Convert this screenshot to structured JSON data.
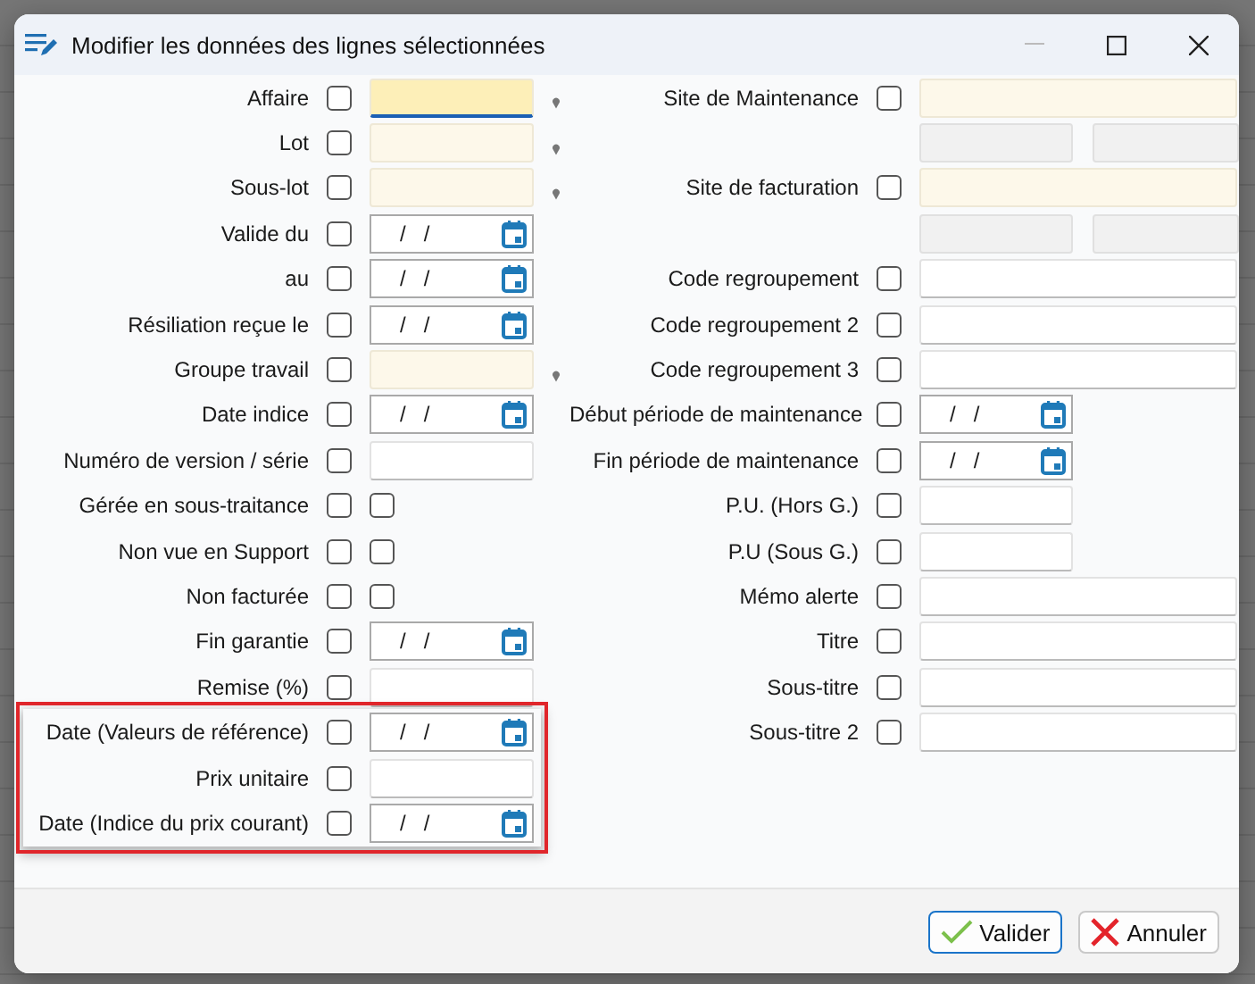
{
  "window": {
    "title": "Modifier les données des lignes sélectionnées"
  },
  "left_rows": [
    {
      "label": "Affaire",
      "checked": false,
      "kind": "lookup",
      "focused": true,
      "highlighted": false
    },
    {
      "label": "Lot",
      "checked": false,
      "kind": "lookup",
      "focused": false,
      "highlighted": false
    },
    {
      "label": "Sous-lot",
      "checked": false,
      "kind": "lookup",
      "focused": false,
      "highlighted": false
    },
    {
      "label": "Valide du",
      "checked": false,
      "kind": "date",
      "value": "/   /",
      "highlighted": false
    },
    {
      "label": "au",
      "checked": false,
      "kind": "date",
      "value": "/   /",
      "highlighted": false
    },
    {
      "label": "Résiliation reçue le",
      "checked": false,
      "kind": "date",
      "value": "/   /",
      "highlighted": false
    },
    {
      "label": "Groupe travail",
      "checked": false,
      "kind": "lookup",
      "focused": false,
      "highlighted": false
    },
    {
      "label": "Date indice",
      "checked": false,
      "kind": "date",
      "value": "/   /",
      "highlighted": false
    },
    {
      "label": "Numéro de version / série",
      "checked": false,
      "kind": "text",
      "highlighted": false
    },
    {
      "label": "Gérée en sous-traitance",
      "checked": false,
      "kind": "check",
      "value_checked": false,
      "highlighted": false
    },
    {
      "label": "Non vue en Support",
      "checked": false,
      "kind": "check",
      "value_checked": false,
      "highlighted": false
    },
    {
      "label": "Non facturée",
      "checked": false,
      "kind": "check",
      "value_checked": false,
      "highlighted": false
    },
    {
      "label": "Fin garantie",
      "checked": false,
      "kind": "date",
      "value": "/   /",
      "highlighted": false
    },
    {
      "label": "Remise (%)",
      "checked": false,
      "kind": "text",
      "highlighted": false
    },
    {
      "label": "Date (Valeurs de référence)",
      "checked": false,
      "kind": "date",
      "value": "/   /",
      "highlighted": true
    },
    {
      "label": "Prix unitaire",
      "checked": false,
      "kind": "text",
      "highlighted": true
    },
    {
      "label": "Date (Indice du prix courant)",
      "checked": false,
      "kind": "date",
      "value": "/   /",
      "highlighted": true
    }
  ],
  "right_rows": [
    {
      "label": "Site de Maintenance",
      "checked": false,
      "kind": "lookup"
    },
    {
      "kind": "pair"
    },
    {
      "label": "Site de facturation",
      "checked": false,
      "kind": "lookup"
    },
    {
      "kind": "pair"
    },
    {
      "label": "Code regroupement",
      "checked": false,
      "kind": "text"
    },
    {
      "label": "Code regroupement 2",
      "checked": false,
      "kind": "text"
    },
    {
      "label": "Code regroupement 3",
      "checked": false,
      "kind": "text"
    },
    {
      "label": "Début période de maintenance",
      "checked": false,
      "kind": "date",
      "value": "/   /"
    },
    {
      "label": "Fin période de maintenance",
      "checked": false,
      "kind": "date",
      "value": "/   /"
    },
    {
      "label": "P.U. (Hors G.)",
      "checked": false,
      "kind": "text_short"
    },
    {
      "label": "P.U (Sous G.)",
      "checked": false,
      "kind": "text_short"
    },
    {
      "label": "Mémo alerte",
      "checked": false,
      "kind": "text"
    },
    {
      "label": "Titre",
      "checked": false,
      "kind": "text"
    },
    {
      "label": "Sous-titre",
      "checked": false,
      "kind": "text"
    },
    {
      "label": "Sous-titre 2",
      "checked": false,
      "kind": "text"
    }
  ],
  "buttons": [
    {
      "label": "Valider",
      "kind": "ok",
      "default": true
    },
    {
      "label": "Annuler",
      "kind": "cancel",
      "default": false
    }
  ]
}
